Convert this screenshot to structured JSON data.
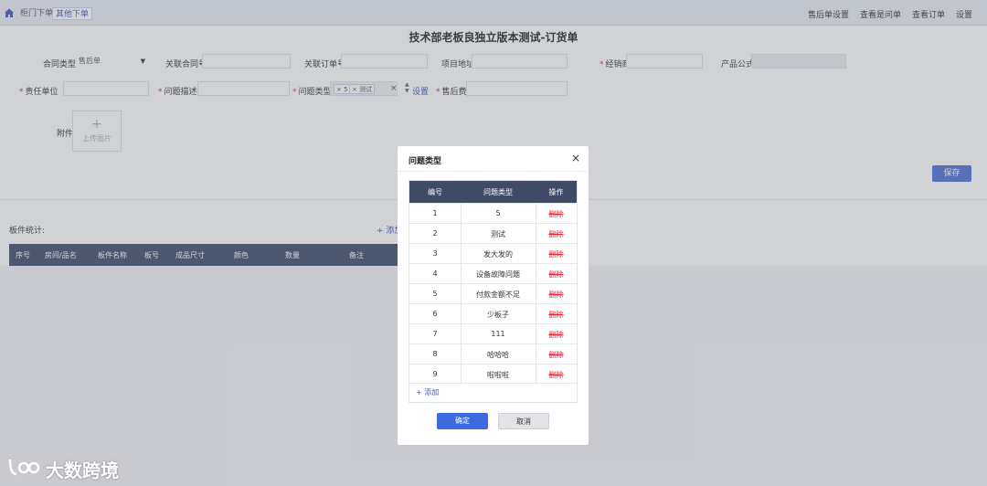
{
  "topbar": {
    "tabs": [
      "柜门下单",
      "其他下单"
    ],
    "nav": [
      "售后单设置",
      "查看是问单",
      "查看订单",
      "设置"
    ]
  },
  "page": {
    "title": "技术部老板良独立版本测试-订货单"
  },
  "form": {
    "contract_type": {
      "label": "合同类型",
      "value": "售后单"
    },
    "related_contract": {
      "label": "关联合同号"
    },
    "related_order": {
      "label": "关联订单号"
    },
    "project_address": {
      "label": "项目地址"
    },
    "dealer": {
      "label": "经销商"
    },
    "product_formula": {
      "label": "产品公式"
    },
    "responsible_unit": {
      "label": "责任单位"
    },
    "problem_desc": {
      "label": "问题描述"
    },
    "problem_type": {
      "label": "问题类型",
      "tags": [
        "5",
        "测试"
      ],
      "clear": "×",
      "setting": "设置"
    },
    "aftersale_fee": {
      "label": "售后费用"
    },
    "attachment": {
      "label": "附件",
      "upload_plus": "+",
      "upload_text": "上传图片"
    },
    "save": "保存"
  },
  "parts": {
    "stats_label": "板件统计:",
    "add": "+ 添加",
    "headers": [
      "序号",
      "房间/品名",
      "板件名称",
      "板号",
      "成品尺寸",
      "颜色",
      "数量",
      "备注"
    ]
  },
  "modal": {
    "title": "问题类型",
    "close": "×",
    "headers": [
      "编号",
      "问题类型",
      "操作"
    ],
    "rows": [
      {
        "id": "1",
        "type": "5",
        "action": "删除"
      },
      {
        "id": "2",
        "type": "测试",
        "action": "删除"
      },
      {
        "id": "3",
        "type": "发大发的",
        "action": "删除"
      },
      {
        "id": "4",
        "type": "设备故障问题",
        "action": "删除"
      },
      {
        "id": "5",
        "type": "付款金额不足",
        "action": "删除"
      },
      {
        "id": "6",
        "type": "少板子",
        "action": "删除"
      },
      {
        "id": "7",
        "type": "111",
        "action": "删除"
      },
      {
        "id": "8",
        "type": "哈哈哈",
        "action": "删除"
      },
      {
        "id": "9",
        "type": "啦啦啦",
        "action": "删除"
      }
    ],
    "add": "+ 添加",
    "ok": "确定",
    "cancel": "取消"
  },
  "watermark": {
    "text": "大数跨境"
  },
  "colors": {
    "primary": "#3d6ae0",
    "header_dark": "#3e4a66",
    "danger": "#e23333"
  }
}
